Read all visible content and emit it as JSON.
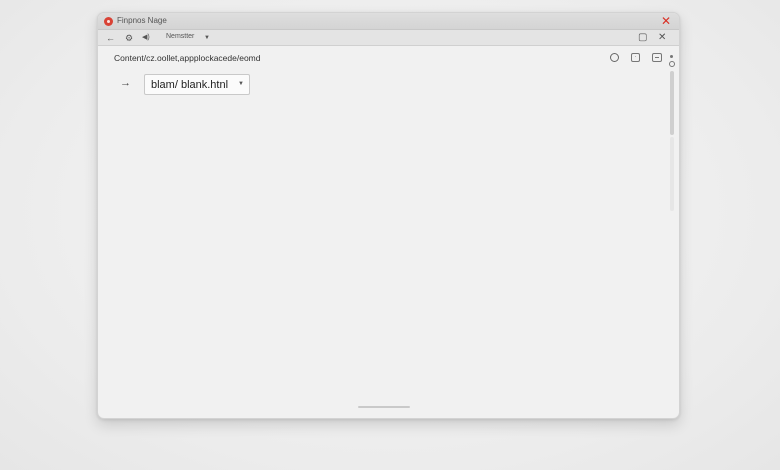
{
  "window": {
    "title": "Finpnos Nage",
    "close_glyph": "✕"
  },
  "navbar": {
    "back_glyph": "←",
    "settings_glyph": "⚙",
    "audio_glyph": "◀)",
    "dropdown_label": "Nemstter",
    "dropdown_caret": "▼",
    "restore_glyph": "▢",
    "close_glyph": "✕"
  },
  "address": {
    "text": "Content/cz.oollet,appplockacede/eomd"
  },
  "toolbar": {
    "icons": [
      "circle-icon",
      "square-dot-icon",
      "menu-lines-icon"
    ],
    "square_glyph": "·"
  },
  "main": {
    "go_arrow_glyph": "→",
    "select": {
      "value": "blam/ blank.htnl",
      "caret": "▼"
    }
  },
  "colors": {
    "close_red": "#d93025",
    "app_icon_red": "#d94235"
  }
}
